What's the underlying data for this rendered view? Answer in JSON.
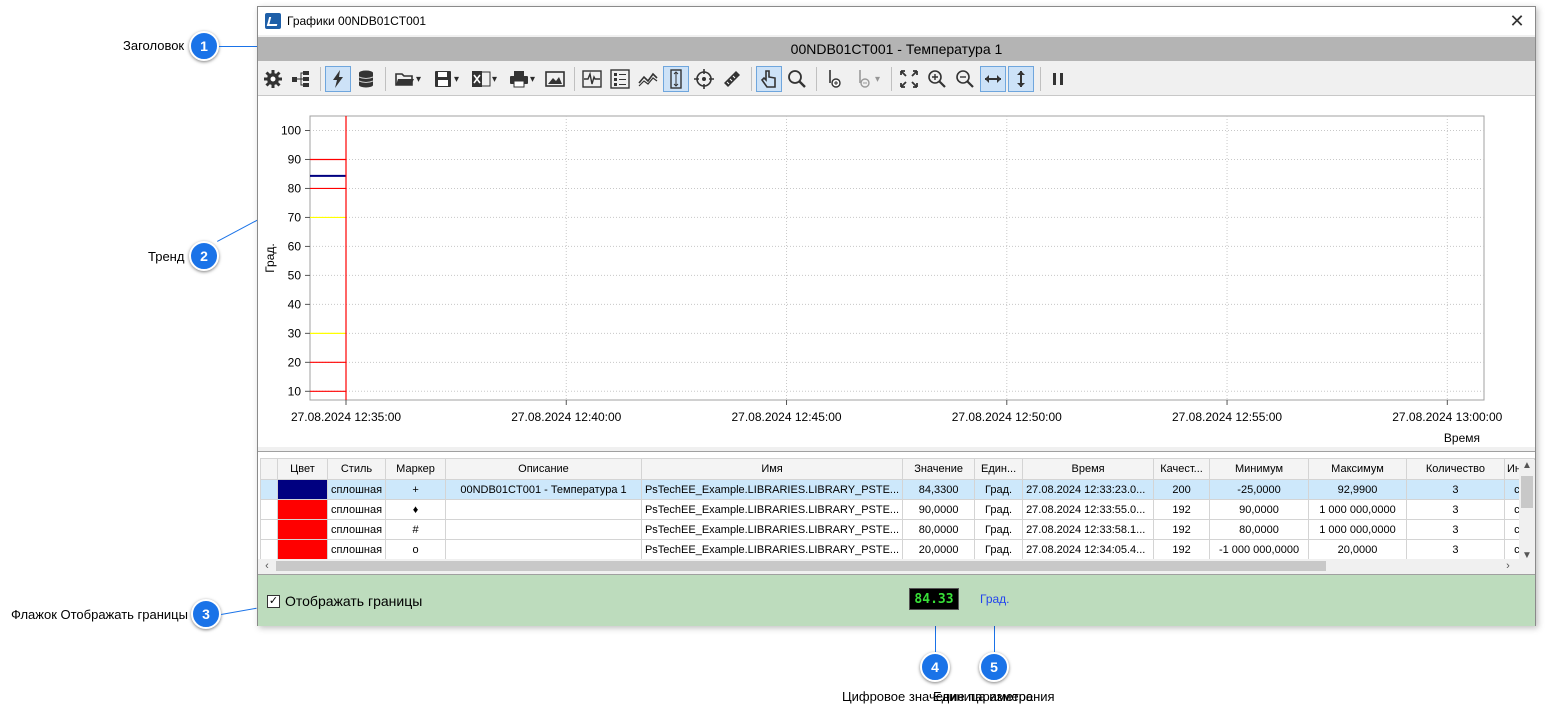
{
  "window": {
    "title": "Графики 00NDB01CT001",
    "close_label": "✕"
  },
  "header": {
    "text": "00NDB01CT001 - Температура 1"
  },
  "callouts": [
    {
      "number": "1",
      "label": "Заголовок"
    },
    {
      "number": "2",
      "label": "Тренд"
    },
    {
      "number": "3",
      "label": "Флажок Отображать границы"
    },
    {
      "number": "4",
      "label": "Цифровое значение параметра"
    },
    {
      "number": "5",
      "label": "Единица измерения"
    }
  ],
  "toolbar": {
    "icons": [
      "gear-icon",
      "tree-icon",
      "lightning-icon",
      "database-icon",
      "folder-icon",
      "save-icon",
      "excel-icon",
      "print-icon",
      "image-icon",
      "signal-icon",
      "list-icon",
      "trend-lines-icon",
      "vertical-measure-icon",
      "crosshair-icon",
      "ruler-icon",
      "hand-pointer-icon",
      "magnifier-icon",
      "add-marker-icon",
      "marker-icon",
      "fit-icon",
      "zoom-in-icon",
      "zoom-out-icon",
      "horizontal-arrows-icon",
      "vertical-arrows-icon",
      "pause-icon"
    ]
  },
  "chart_data": {
    "type": "line",
    "ylabel": "Град.",
    "xlabel": "Время",
    "ylim": [
      7,
      105
    ],
    "y_ticks": [
      "100",
      "90",
      "80",
      "70",
      "60",
      "50",
      "40",
      "30",
      "20",
      "10"
    ],
    "x_ticks": [
      "27.08.2024 12:35:00",
      "27.08.2024 12:40:00",
      "27.08.2024 12:45:00",
      "27.08.2024 12:50:00",
      "27.08.2024 12:55:00",
      "27.08.2024 13:00:00"
    ],
    "cursor_time": "27.08.2024 12:35:00",
    "grid": true,
    "series": [
      {
        "value": 84.33,
        "color": "#000080"
      },
      {
        "value": 90,
        "color": "#ff0000"
      },
      {
        "value": 80,
        "color": "#ff0000"
      },
      {
        "value": 70,
        "color": "#ffff00"
      },
      {
        "value": 30,
        "color": "#ffff00"
      },
      {
        "value": 20,
        "color": "#ff0000"
      },
      {
        "value": 10,
        "color": "#ff0000"
      }
    ]
  },
  "table": {
    "columns": [
      "Цвет",
      "Стиль",
      "Маркер",
      "Описание",
      "Имя",
      "Значение",
      "Един...",
      "Время",
      "Качест...",
      "Минимум",
      "Максимум",
      "Количество",
      "Инте"
    ],
    "rows": [
      {
        "color": "#000080",
        "style": "сплошная",
        "marker": "+",
        "description": "00NDB01CT001 - Температура 1",
        "name": "PsTechEE_Example.LIBRARIES.LIBRARY_PSTE...",
        "value": "84,3300",
        "unit": "Град.",
        "time": "27.08.2024 12:33:23.0...",
        "quality": "200",
        "min": "-25,0000",
        "max": "92,9900",
        "count": "3",
        "interp": "ст"
      },
      {
        "color": "#ff0000",
        "style": "сплошная",
        "marker": "♦",
        "description": "",
        "name": "PsTechEE_Example.LIBRARIES.LIBRARY_PSTE...",
        "value": "90,0000",
        "unit": "Град.",
        "time": "27.08.2024 12:33:55.0...",
        "quality": "192",
        "min": "90,0000",
        "max": "1 000 000,0000",
        "count": "3",
        "interp": "ст"
      },
      {
        "color": "#ff0000",
        "style": "сплошная",
        "marker": "#",
        "description": "",
        "name": "PsTechEE_Example.LIBRARIES.LIBRARY_PSTE...",
        "value": "80,0000",
        "unit": "Град.",
        "time": "27.08.2024 12:33:58.1...",
        "quality": "192",
        "min": "80,0000",
        "max": "1 000 000,0000",
        "count": "3",
        "interp": "ст"
      },
      {
        "color": "#ff0000",
        "style": "сплошная",
        "marker": "o",
        "description": "",
        "name": "PsTechEE_Example.LIBRARIES.LIBRARY_PSTE...",
        "value": "20,0000",
        "unit": "Град.",
        "time": "27.08.2024 12:34:05.4...",
        "quality": "192",
        "min": "-1 000 000,0000",
        "max": "20,0000",
        "count": "3",
        "interp": "ст"
      }
    ]
  },
  "footer": {
    "checkbox_label": "Отображать границы",
    "checkbox_checked": true,
    "checkbox_mark": "✓",
    "digital_value": "84.33",
    "unit": "Град."
  }
}
